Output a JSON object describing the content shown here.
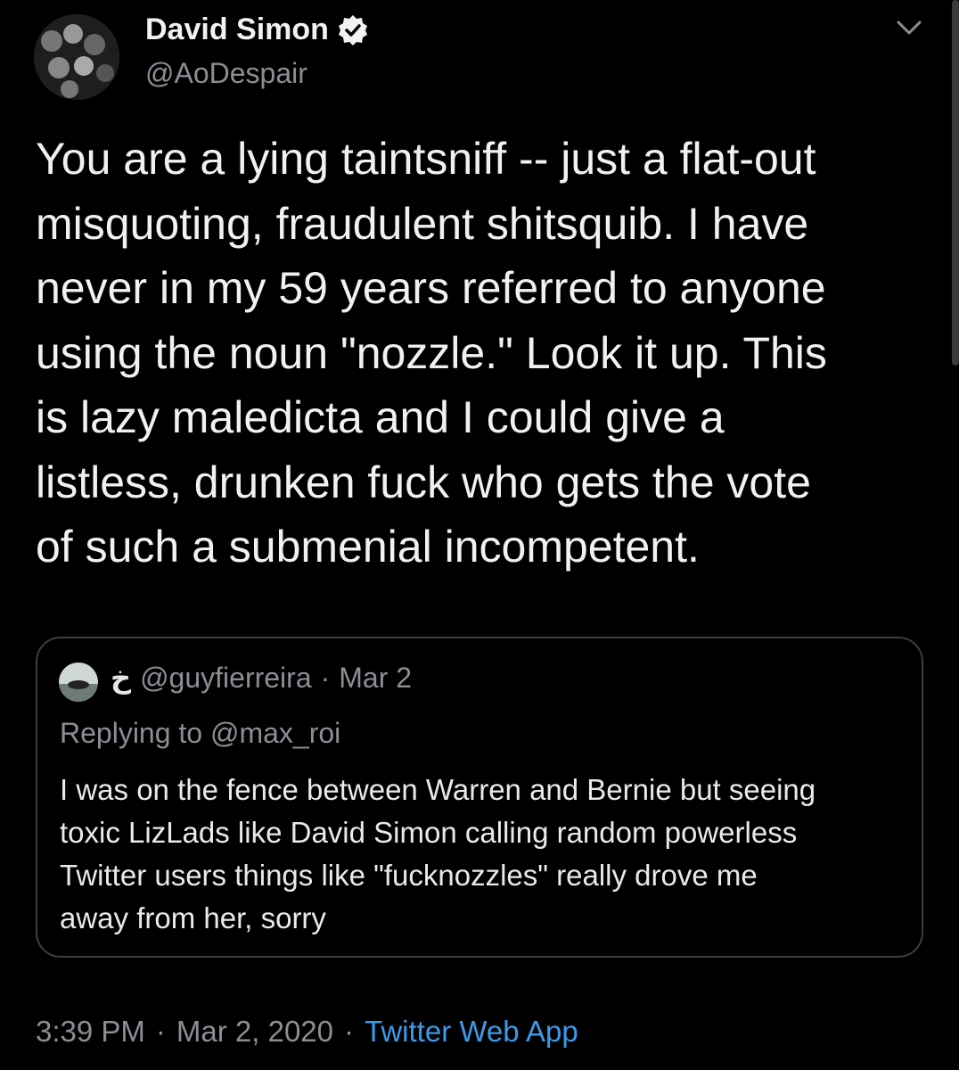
{
  "tweet": {
    "author_name": "David Simon",
    "author_handle": "@AoDespair",
    "verified_icon": "verified-badge-icon",
    "menu_icon": "chevron-down-icon",
    "text": "You are a lying taintsniff -- just a flat-out\nmisquoting, fraudulent shitsquib. I have\nnever in my 59 years referred to anyone\nusing the noun \"nozzle.\" Look it up. This\nis lazy maledicta and I could give a\nlistless, drunken fuck who gets the vote\nof such a submenial incompetent.",
    "time": "3:39 PM",
    "date": "Mar 2, 2020",
    "source": "Twitter Web App",
    "separator": "·"
  },
  "quoted": {
    "name": "خ",
    "handle": "@guyfierreira",
    "date": "Mar 2",
    "separator": "·",
    "replying_to": "Replying to @max_roi",
    "text": "I was on the fence between Warren and Bernie but seeing\ntoxic LizLads like David Simon calling random powerless\nTwitter users things like \"fucknozzles\" really drove me\naway from her, sorry"
  },
  "colors": {
    "background": "#000000",
    "text": "#f1f1f1",
    "secondary": "#8a8f94",
    "link": "#3d9ae8",
    "border": "#3b3f43"
  }
}
